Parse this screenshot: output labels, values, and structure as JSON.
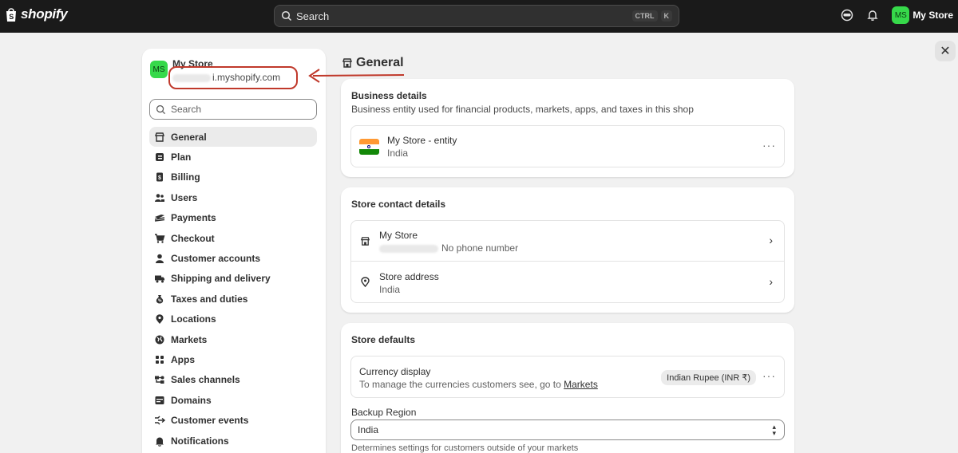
{
  "topbar": {
    "brand": "shopify",
    "search_placeholder": "Search",
    "shortcut_1": "CTRL",
    "shortcut_2": "K",
    "avatar_initials": "MS",
    "store_name": "My Store"
  },
  "close_label": "✕",
  "sidebar": {
    "avatar_initials": "MS",
    "store_name": "My Store",
    "store_domain": "i.myshopify.com",
    "search_placeholder": "Search",
    "items": [
      {
        "label": "General",
        "icon": "store-icon",
        "active": true
      },
      {
        "label": "Plan",
        "icon": "plan-icon"
      },
      {
        "label": "Billing",
        "icon": "billing-icon"
      },
      {
        "label": "Users",
        "icon": "users-icon"
      },
      {
        "label": "Payments",
        "icon": "payments-icon"
      },
      {
        "label": "Checkout",
        "icon": "cart-icon"
      },
      {
        "label": "Customer accounts",
        "icon": "person-icon"
      },
      {
        "label": "Shipping and delivery",
        "icon": "truck-icon"
      },
      {
        "label": "Taxes and duties",
        "icon": "tax-icon"
      },
      {
        "label": "Locations",
        "icon": "location-icon"
      },
      {
        "label": "Markets",
        "icon": "globe-icon"
      },
      {
        "label": "Apps",
        "icon": "apps-icon"
      },
      {
        "label": "Sales channels",
        "icon": "channels-icon"
      },
      {
        "label": "Domains",
        "icon": "domains-icon"
      },
      {
        "label": "Customer events",
        "icon": "events-icon"
      },
      {
        "label": "Notifications",
        "icon": "bell-icon"
      }
    ]
  },
  "main": {
    "title": "General",
    "business": {
      "title": "Business details",
      "subtitle": "Business entity used for financial products, markets, apps, and taxes in this shop",
      "entity_name": "My Store - entity",
      "entity_country": "India",
      "more": "···"
    },
    "contact": {
      "title": "Store contact details",
      "store_name": "My Store",
      "phone": "No phone number",
      "address_label": "Store address",
      "address_value": "India",
      "chevron": "›"
    },
    "defaults": {
      "title": "Store defaults",
      "currency_label": "Currency display",
      "currency_desc": "To manage the currencies customers see, go to",
      "currency_link": "Markets",
      "currency_badge": "Indian Rupee (INR ₹)",
      "more": "···",
      "backup_label": "Backup Region",
      "backup_value": "India",
      "backup_help": "Determines settings for customers outside of your markets"
    }
  },
  "colors": {
    "accent_green": "#36d94a",
    "annotation_red": "#c0392b",
    "topbar": "#1a1a1a"
  }
}
